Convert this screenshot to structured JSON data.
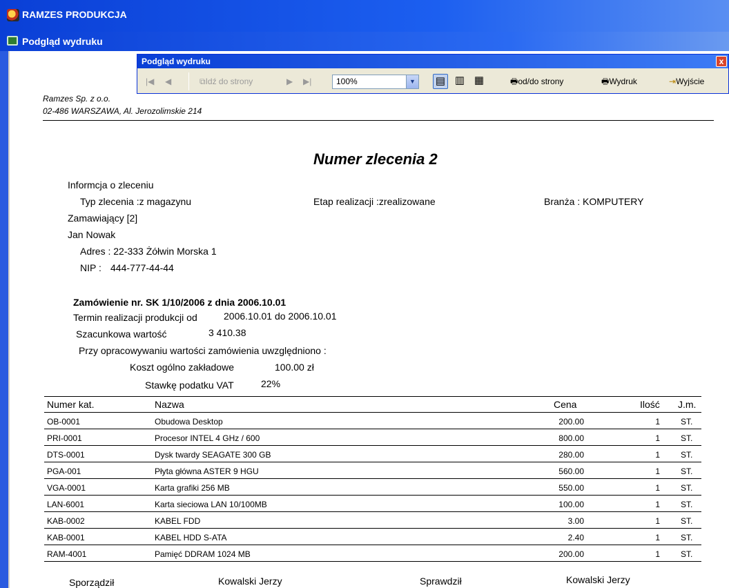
{
  "app": {
    "title": "RAMZES PRODUKCJA"
  },
  "mdi_window": {
    "title": "Podgląd wydruku"
  },
  "preview_window": {
    "title": "Podgląd wydruku",
    "close_label": "x",
    "toolbar": {
      "first_page": "|◀",
      "prev_page": "◀",
      "goto_page": "Idź do strony",
      "next_page": "▶",
      "last_page": "▶|",
      "zoom_value": "100%",
      "page_range": "od/do strony",
      "print": "Wydruk",
      "exit": "Wyjście"
    }
  },
  "document": {
    "company_name": "Ramzes Sp. z o.o.",
    "company_address": "02-486 WARSZAWA, Al. Jerozolimskie 214",
    "title": "Numer zlecenia 2",
    "info_header": "Informcja o zleceniu",
    "order_type": "Typ zlecenia :z magazynu",
    "stage": "Etap realizacji :zrealizowane",
    "industry": "Branża : KOMPUTERY",
    "orderer_label": "Zamawiający  [2]",
    "orderer_name": "Jan Nowak",
    "address": "Adres : 22-333 Żółwin Morska 1",
    "nip_label": "NIP :",
    "nip_value": "444-777-44-44",
    "order_header": "Zamówienie nr.  SK 1/10/2006 z dnia 2006.10.01",
    "production_term_label": "Termin realizacji produkcji od",
    "production_term_value": "2006.10.01 do 2006.10.01",
    "estimated_value_label": "Szacunkowa wartość",
    "estimated_value": "3 410.38",
    "included_label": "Przy opracowywaniu wartości zamówienia uwzględniono :",
    "overhead_label": "Koszt ogólno zakładowe",
    "overhead_value": "100.00 zł",
    "vat_label": "Stawkę podatku VAT",
    "vat_value": "22%",
    "table": {
      "headers": {
        "code": "Numer kat.",
        "name": "Nazwa",
        "price": "Cena",
        "qty": "Ilość",
        "unit": "J.m."
      },
      "rows": [
        {
          "code": "OB-0001",
          "name": "Obudowa Desktop",
          "price": "200.00",
          "qty": "1",
          "unit": "ST."
        },
        {
          "code": "PRI-0001",
          "name": "Procesor INTEL 4 GHz / 600",
          "price": "800.00",
          "qty": "1",
          "unit": "ST."
        },
        {
          "code": "DTS-0001",
          "name": "Dysk twardy SEAGATE 300 GB",
          "price": "280.00",
          "qty": "1",
          "unit": "ST."
        },
        {
          "code": "PGA-001",
          "name": "Płyta główna ASTER 9 HGU",
          "price": "560.00",
          "qty": "1",
          "unit": "ST."
        },
        {
          "code": "VGA-0001",
          "name": "Karta grafiki 256 MB",
          "price": "550.00",
          "qty": "1",
          "unit": "ST."
        },
        {
          "code": "LAN-6001",
          "name": "Karta sieciowa LAN 10/100MB",
          "price": "100.00",
          "qty": "1",
          "unit": "ST."
        },
        {
          "code": "KAB-0002",
          "name": "KABEL FDD",
          "price": "3.00",
          "qty": "1",
          "unit": "ST."
        },
        {
          "code": "KAB-0001",
          "name": "KABEL HDD S-ATA",
          "price": "2.40",
          "qty": "1",
          "unit": "ST."
        },
        {
          "code": "RAM-4001",
          "name": "Pamięć DDRAM 1024 MB",
          "price": "200.00",
          "qty": "1",
          "unit": "ST."
        }
      ]
    },
    "footer": {
      "prepared_label": "Sporządził",
      "prepared_by": "Kowalski Jerzy",
      "checked_label": "Sprawdził",
      "checked_by": "Kowalski Jerzy"
    }
  }
}
